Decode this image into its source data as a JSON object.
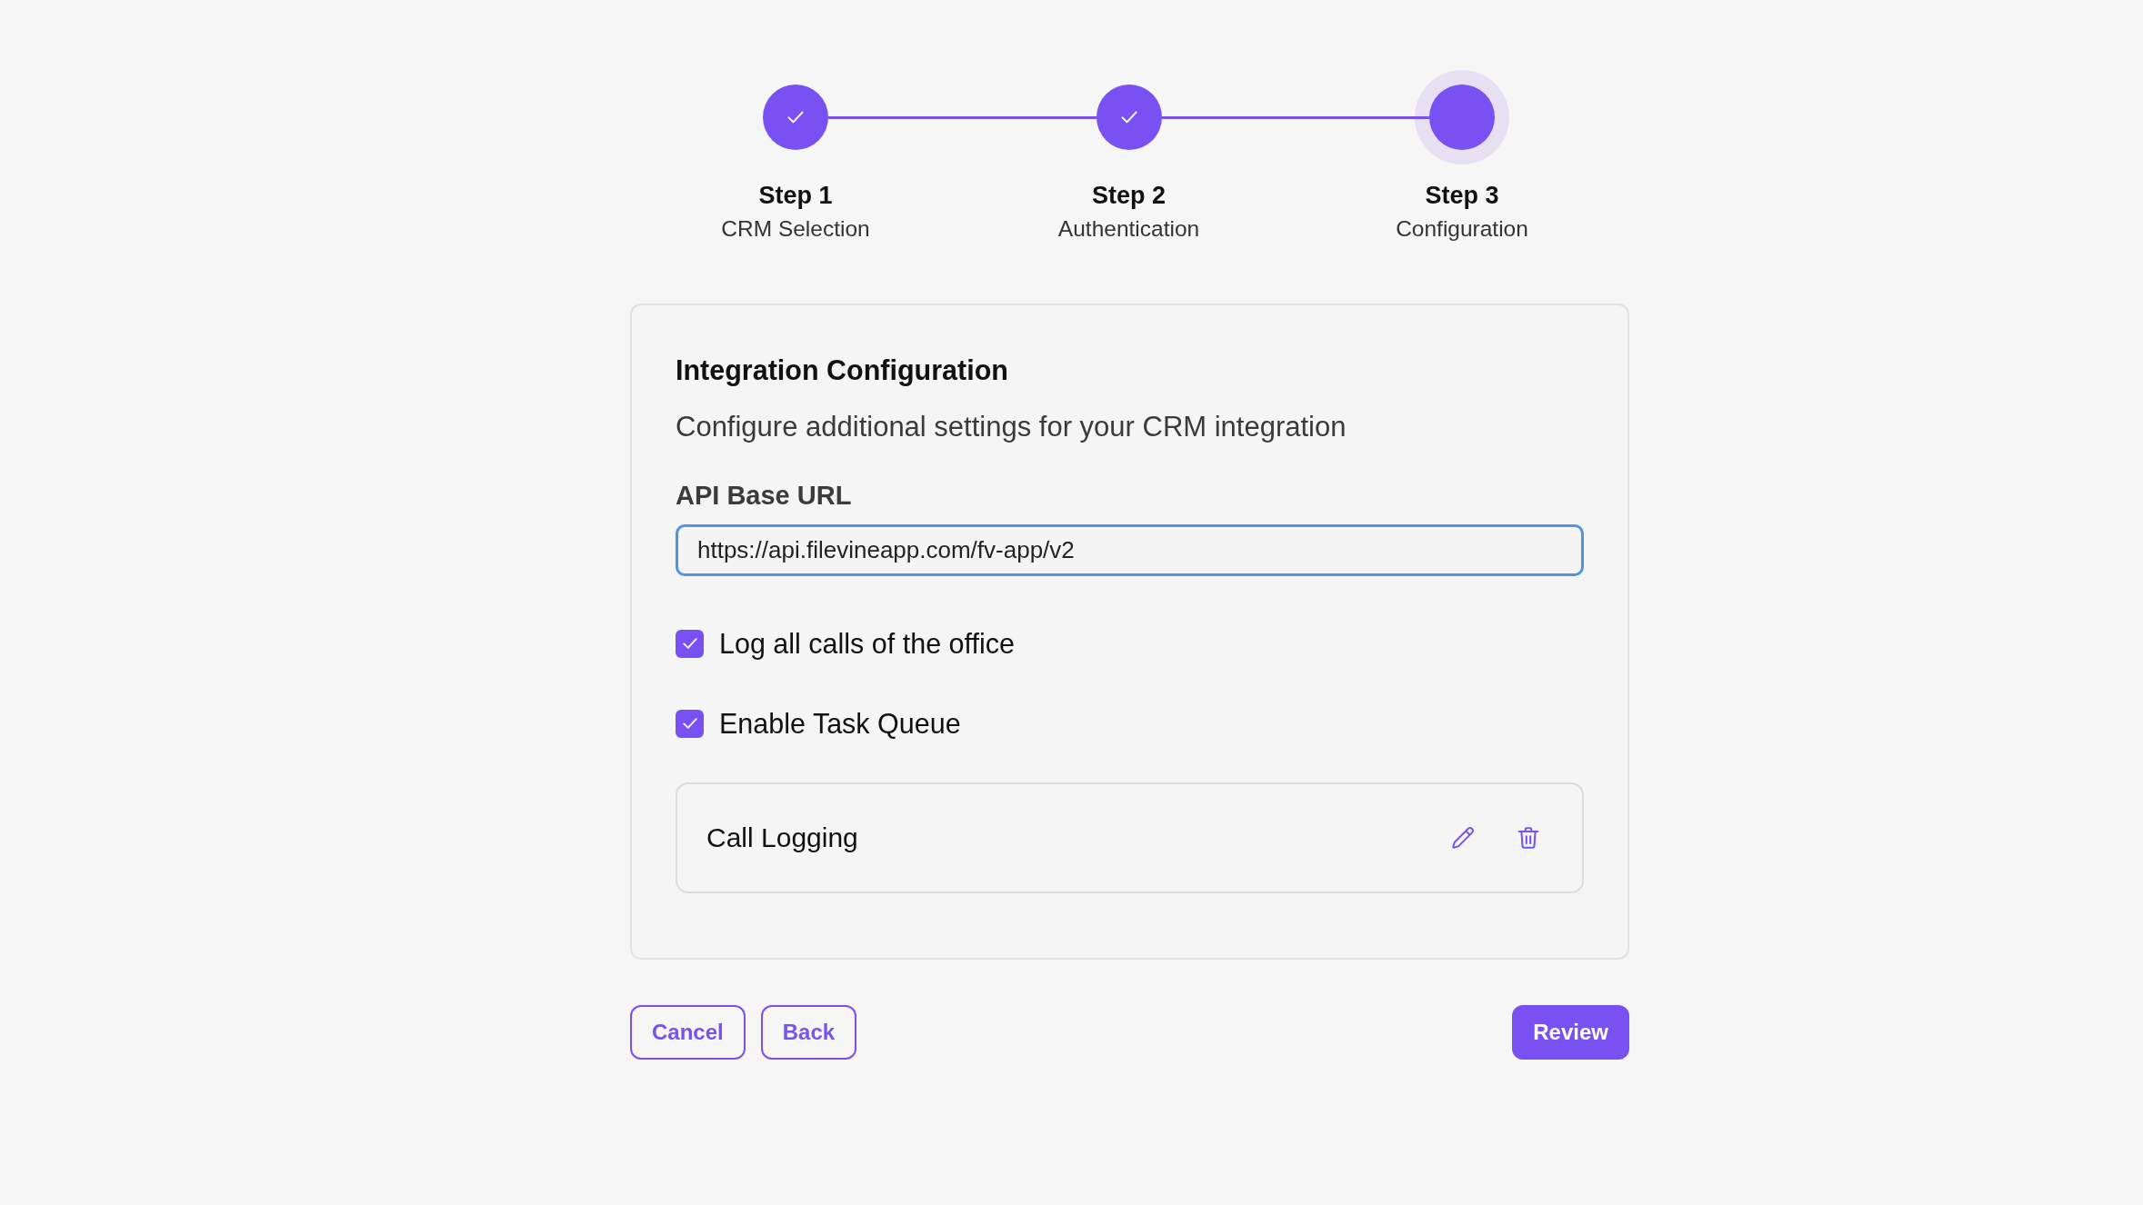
{
  "steps": [
    {
      "title": "Step 1",
      "subtitle": "CRM Selection",
      "completed": true,
      "current": false
    },
    {
      "title": "Step 2",
      "subtitle": "Authentication",
      "completed": true,
      "current": false
    },
    {
      "title": "Step 3",
      "subtitle": "Configuration",
      "completed": false,
      "current": true
    }
  ],
  "card": {
    "title": "Integration Configuration",
    "description": "Configure additional settings for your CRM integration",
    "api_base_url": {
      "label": "API Base URL",
      "value": "https://api.filevineapp.com/fv-app/v2",
      "focused": true
    },
    "options": [
      {
        "label": "Log all calls of the office",
        "checked": true
      },
      {
        "label": "Enable Task Queue",
        "checked": true
      }
    ],
    "items": [
      {
        "label": "Call Logging"
      }
    ]
  },
  "buttons": [
    {
      "label": "Cancel",
      "kind": "outline"
    },
    {
      "label": "Back",
      "kind": "outline"
    },
    {
      "label": "Review",
      "kind": "primary"
    }
  ]
}
